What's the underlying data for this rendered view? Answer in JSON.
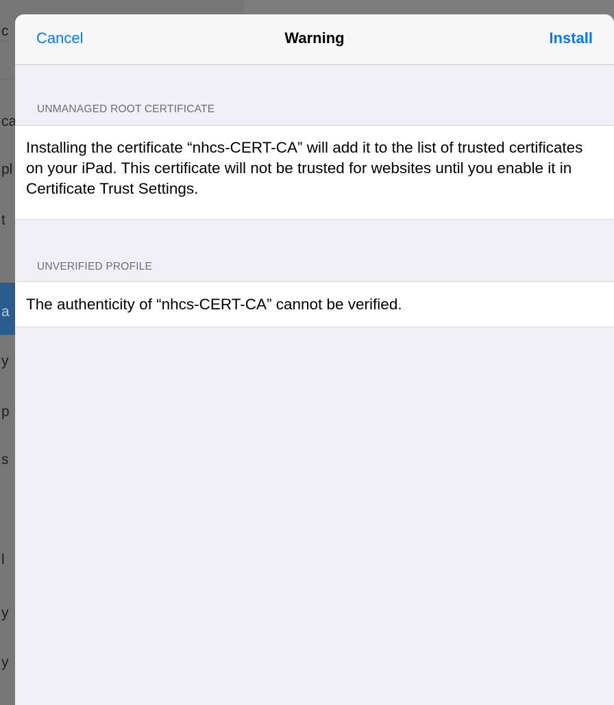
{
  "background_app": {
    "row_fragments": [
      "c",
      "ca",
      "pl",
      "t",
      "a",
      "y",
      "p",
      "s",
      "l",
      "y",
      "y"
    ]
  },
  "navbar": {
    "cancel_label": "Cancel",
    "title": "Warning",
    "install_label": "Install"
  },
  "sections": [
    {
      "header": "UNMANAGED ROOT CERTIFICATE",
      "body": "Installing the certificate “nhcs-CERT-CA” will add it to the list of trusted certificates on your iPad. This certificate will not be trusted for websites until you enable it in Certificate Trust Settings."
    },
    {
      "header": "UNVERIFIED PROFILE",
      "body": "The authenticity of “nhcs-CERT-CA” cannot be verified."
    }
  ],
  "colors": {
    "accent": "#007aff",
    "group_background": "#efeff4",
    "header_text": "#6d6d72"
  }
}
